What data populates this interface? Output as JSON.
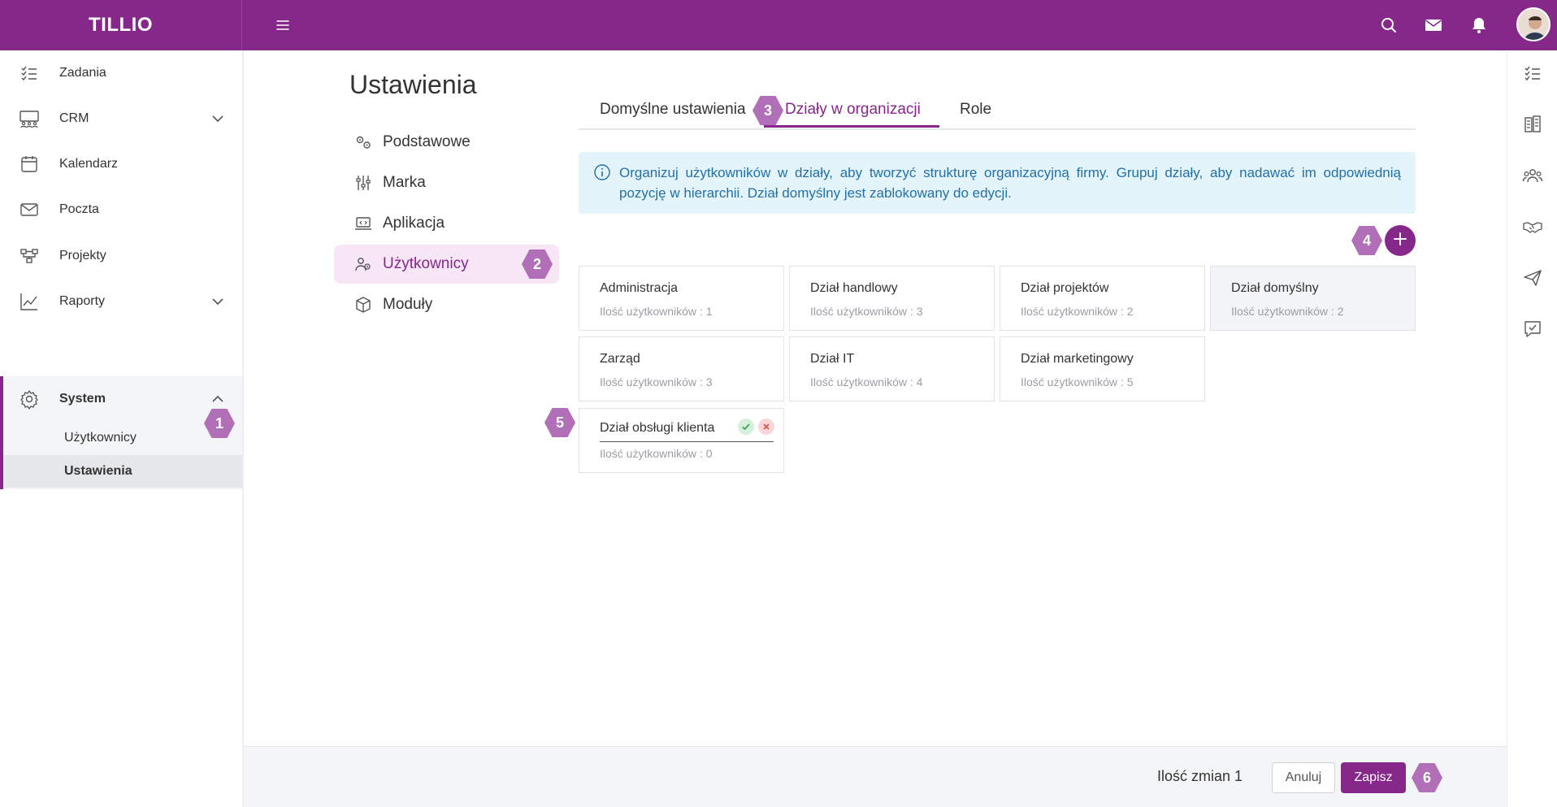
{
  "app": {
    "logo": "TILLIO"
  },
  "sidebar": {
    "items": [
      {
        "label": "Zadania",
        "icon": "tasks-icon"
      },
      {
        "label": "CRM",
        "icon": "crm-icon"
      },
      {
        "label": "Kalendarz",
        "icon": "calendar-icon"
      },
      {
        "label": "Poczta",
        "icon": "mail-icon"
      },
      {
        "label": "Projekty",
        "icon": "projects-icon"
      },
      {
        "label": "Raporty",
        "icon": "reports-icon"
      },
      {
        "label": "System",
        "icon": "gear-icon"
      }
    ],
    "system_sub": [
      {
        "label": "Użytkownicy"
      },
      {
        "label": "Ustawienia"
      }
    ]
  },
  "page": {
    "title": "Ustawienia"
  },
  "settings_nav": [
    {
      "label": "Podstawowe",
      "icon": "gears-icon"
    },
    {
      "label": "Marka",
      "icon": "sliders-icon"
    },
    {
      "label": "Aplikacja",
      "icon": "laptop-icon"
    },
    {
      "label": "Użytkownicy",
      "icon": "users-icon"
    },
    {
      "label": "Moduły",
      "icon": "cube-icon"
    }
  ],
  "tabs": [
    {
      "label": "Domyślne ustawienia"
    },
    {
      "label": "Działy w organizacji"
    },
    {
      "label": "Role"
    }
  ],
  "info": {
    "text": "Organizuj użytkowników w działy, aby tworzyć strukturę organizacyjną firmy. Grupuj działy, aby nadawać im odpowiednią pozycję w hierarchii. Dział domyślny jest zablokowany do edycji."
  },
  "departments": [
    {
      "name": "Administracja",
      "count": "Ilość użytkowników : 1"
    },
    {
      "name": "Dział handlowy",
      "count": "Ilość użytkowników : 3"
    },
    {
      "name": "Dział projektów",
      "count": "Ilość użytkowników : 2"
    },
    {
      "name": "Dział domyślny",
      "count": "Ilość użytkowników : 2"
    },
    {
      "name": "Zarząd",
      "count": "Ilość użytkowników : 3"
    },
    {
      "name": "Dział IT",
      "count": "Ilość użytkowników : 4"
    },
    {
      "name": "Dział marketingowy",
      "count": "Ilość użytkowników : 5"
    },
    {
      "name": "Dział obsługi klienta",
      "count": "Ilość użytkowników : 0"
    }
  ],
  "badges": [
    "1",
    "2",
    "3",
    "4",
    "5",
    "6"
  ],
  "footer": {
    "changes": "Ilość zmian 1",
    "cancel": "Anuluj",
    "save": "Zapisz"
  },
  "colors": {
    "accent": "#86278a",
    "badge": "#b06fb6",
    "info_bg": "#e3f5fb",
    "info_text": "#246fa8"
  }
}
